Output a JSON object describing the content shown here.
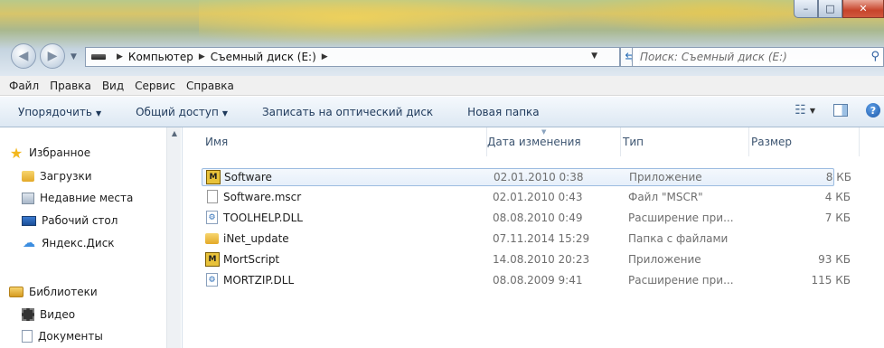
{
  "window": {
    "minimize": "–",
    "maximize": "□",
    "close": "✕"
  },
  "address": {
    "crumbs": [
      "Компьютер",
      "Съемный диск (E:)"
    ]
  },
  "search": {
    "placeholder": "Поиск: Съемный диск (E:)"
  },
  "menu": [
    "Файл",
    "Правка",
    "Вид",
    "Сервис",
    "Справка"
  ],
  "toolbar": {
    "organize": "Упорядочить",
    "share": "Общий доступ",
    "burn": "Записать на оптический диск",
    "new_folder": "Новая папка"
  },
  "nav": {
    "favorites": "Избранное",
    "downloads": "Загрузки",
    "recent": "Недавние места",
    "desktop": "Рабочий стол",
    "yandex": "Яндекс.Диск",
    "libraries": "Библиотеки",
    "video": "Видео",
    "documents": "Документы"
  },
  "columns": {
    "name": "Имя",
    "date": "Дата изменения",
    "type": "Тип",
    "size": "Размер"
  },
  "files": [
    {
      "name": "Software",
      "date": "02.01.2010 0:38",
      "type": "Приложение",
      "size": "8 КБ",
      "icon": "mortscript-app-icon"
    },
    {
      "name": "Software.mscr",
      "date": "02.01.2010 0:43",
      "type": "Файл \"MSCR\"",
      "size": "4 КБ",
      "icon": "file-icon"
    },
    {
      "name": "TOOLHELP.DLL",
      "date": "08.08.2010 0:49",
      "type": "Расширение при...",
      "size": "7 КБ",
      "icon": "dll-icon"
    },
    {
      "name": "iNet_update",
      "date": "07.11.2014 15:29",
      "type": "Папка с файлами",
      "size": "",
      "icon": "folder-icon"
    },
    {
      "name": "MortScript",
      "date": "14.08.2010 20:23",
      "type": "Приложение",
      "size": "93 КБ",
      "icon": "mortscript-app-icon"
    },
    {
      "name": "MORTZIP.DLL",
      "date": "08.08.2009 9:41",
      "type": "Расширение при...",
      "size": "115 КБ",
      "icon": "dll-icon"
    }
  ]
}
